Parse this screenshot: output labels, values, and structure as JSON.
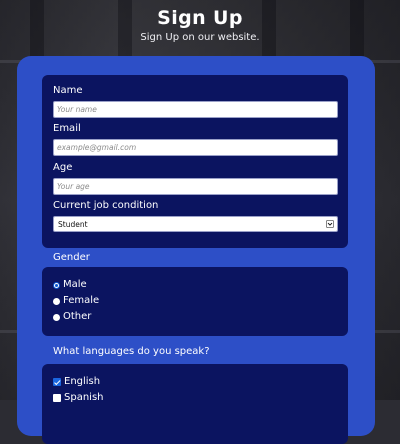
{
  "header": {
    "title": "Sign Up",
    "subtitle": "Sign Up on our website."
  },
  "form": {
    "name": {
      "label": "Name",
      "placeholder": "Your name",
      "value": ""
    },
    "email": {
      "label": "Email",
      "placeholder": "example@gmail.com",
      "value": ""
    },
    "age": {
      "label": "Age",
      "placeholder": "Your age",
      "value": ""
    },
    "job": {
      "label": "Current job condition",
      "selected": "Student"
    },
    "gender": {
      "label": "Gender",
      "options": [
        {
          "label": "Male",
          "checked": true
        },
        {
          "label": "Female",
          "checked": false
        },
        {
          "label": "Other",
          "checked": false
        }
      ]
    },
    "languages": {
      "label": "What languages do you speak?",
      "options": [
        {
          "label": "English",
          "checked": true
        },
        {
          "label": "Spanish",
          "checked": false
        }
      ]
    }
  },
  "colors": {
    "card": "#2d4fc7",
    "panel": "#0b1460",
    "accent": "#1a66e0"
  }
}
